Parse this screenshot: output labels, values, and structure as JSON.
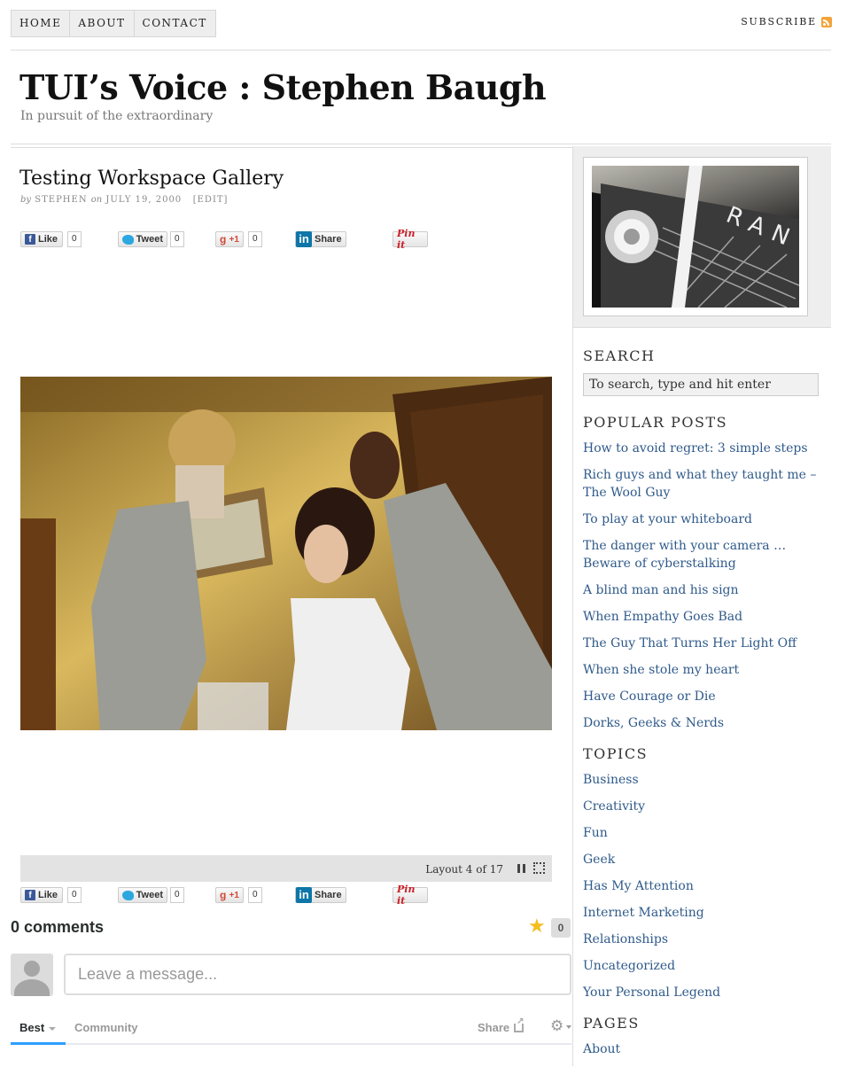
{
  "nav": {
    "items": [
      "HOME",
      "ABOUT",
      "CONTACT"
    ],
    "subscribe": "SUBSCRIBE"
  },
  "site": {
    "title": "TUI’s Voice : Stephen Baugh",
    "tagline": "In pursuit of the extraordinary"
  },
  "post": {
    "title": "Testing Workspace Gallery",
    "by": "by",
    "author": "STEPHEN",
    "on": "on",
    "date": "JULY 19, 2000",
    "edit": "[EDIT]"
  },
  "share": {
    "like": "Like",
    "like_count": "0",
    "tweet": "Tweet",
    "tweet_count": "0",
    "plus": "+1",
    "plus_count": "0",
    "linkedin": "Share",
    "pin": "Pin it"
  },
  "gallery": {
    "label": "Layout 4 of 17"
  },
  "comments": {
    "count": "0 comments",
    "star_count": "0",
    "placeholder": "Leave a message...",
    "tab_best": "Best",
    "tab_community": "Community",
    "share": "Share"
  },
  "sidebar": {
    "search_heading": "SEARCH",
    "search_value": "To search, type and hit enter",
    "popular_heading": "POPULAR POSTS",
    "popular": [
      "How to avoid regret: 3 simple steps",
      "Rich guys and what they taught me – The Wool Guy",
      "To play at your whiteboard",
      "The danger with your camera … Beware of cyberstalking",
      "A blind man and his sign",
      "When Empathy Goes Bad",
      "The Guy That Turns Her Light Off",
      "When she stole my heart",
      "Have Courage or Die",
      "Dorks, Geeks & Nerds"
    ],
    "topics_heading": "TOPICS",
    "topics": [
      "Business",
      "Creativity",
      "Fun",
      "Geek",
      "Has My Attention",
      "Internet Marketing",
      "Relationships",
      "Uncategorized",
      "Your Personal Legend"
    ],
    "pages_heading": "PAGES",
    "pages": [
      "About"
    ],
    "image_text": "RAN"
  },
  "colors": {
    "link": "#2f5a8a",
    "disqus_blue": "#2e9fff",
    "star": "#f5bd1f"
  }
}
